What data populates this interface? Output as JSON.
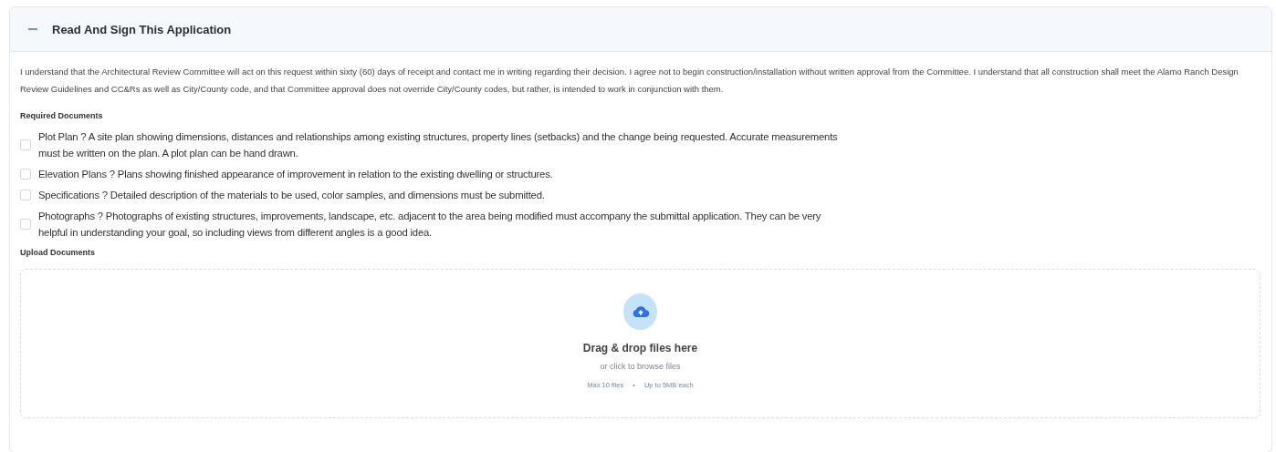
{
  "section": {
    "title": "Read And Sign This Application",
    "expanded": true
  },
  "agreement": "I understand that the Architectural Review Committee will act on this request within sixty (60) days of receipt and contact me in writing regarding their decision. I agree not to begin construction/installation without written approval from the Committee. I understand that all construction shall meet the Alamo Ranch Design Review Guidelines and CC&Rs as well as City/County code, and that Committee approval does not override City/County codes, but rather, is intended to work in conjunction with them.",
  "required_documents": {
    "heading": "Required Documents",
    "items": [
      {
        "label": "Plot Plan ? A site plan showing dimensions, distances and relationships among existing structures, property lines (setbacks) and the change being requested. Accurate measurements must be written on the plan. A plot plan can be hand drawn.",
        "checked": false
      },
      {
        "label": "Elevation Plans ? Plans showing finished appearance of improvement in relation to the existing dwelling or structures.",
        "checked": false
      },
      {
        "label": "Specifications ? Detailed description of the materials to be used, color samples, and dimensions must be submitted.",
        "checked": false
      },
      {
        "label": "Photographs ? Photographs of existing structures, improvements, landscape, etc. adjacent to the area being modified must accompany the submittal application. They can be very helpful in understanding your goal, so including views from different angles is a good idea.",
        "checked": false
      }
    ]
  },
  "upload": {
    "heading": "Upload Documents",
    "title": "Drag & drop files here",
    "subtitle": "or click to browse files",
    "limits": [
      "Max 10 files",
      "•",
      "Up to 5MB each"
    ]
  }
}
